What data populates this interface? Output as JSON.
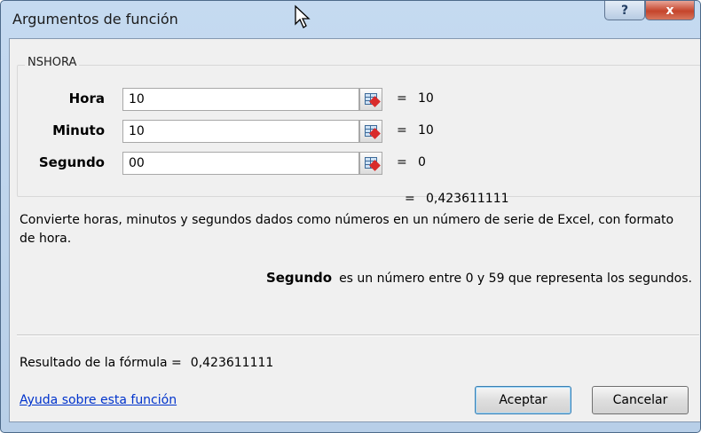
{
  "window": {
    "title": "Argumentos de función",
    "help_glyph": "?",
    "close_glyph": "x"
  },
  "function_name": "NSHORA",
  "arguments": [
    {
      "label": "Hora",
      "value": "10",
      "equals": "=",
      "result": "10"
    },
    {
      "label": "Minuto",
      "value": "10",
      "equals": "=",
      "result": "10"
    },
    {
      "label": "Segundo",
      "value": "00",
      "equals": "=",
      "result": "0"
    }
  ],
  "function_result": {
    "equals": "=",
    "value": "0,423611111"
  },
  "description": "Convierte horas, minutos y segundos dados como números en un número de serie de Excel, con formato de hora.",
  "parameter_help": {
    "name": "Segundo",
    "text": "es un número entre 0 y 59 que representa los segundos."
  },
  "formula_result": {
    "label": "Resultado de la fórmula =",
    "value": "0,423611111"
  },
  "help_link": "Ayuda sobre esta función",
  "buttons": {
    "ok": "Aceptar",
    "cancel": "Cancelar"
  },
  "colors": {
    "title_bg": "#c5daf0",
    "close_red": "#c5442b",
    "link_blue": "#0033cc",
    "ok_border": "#3c7fb1"
  }
}
